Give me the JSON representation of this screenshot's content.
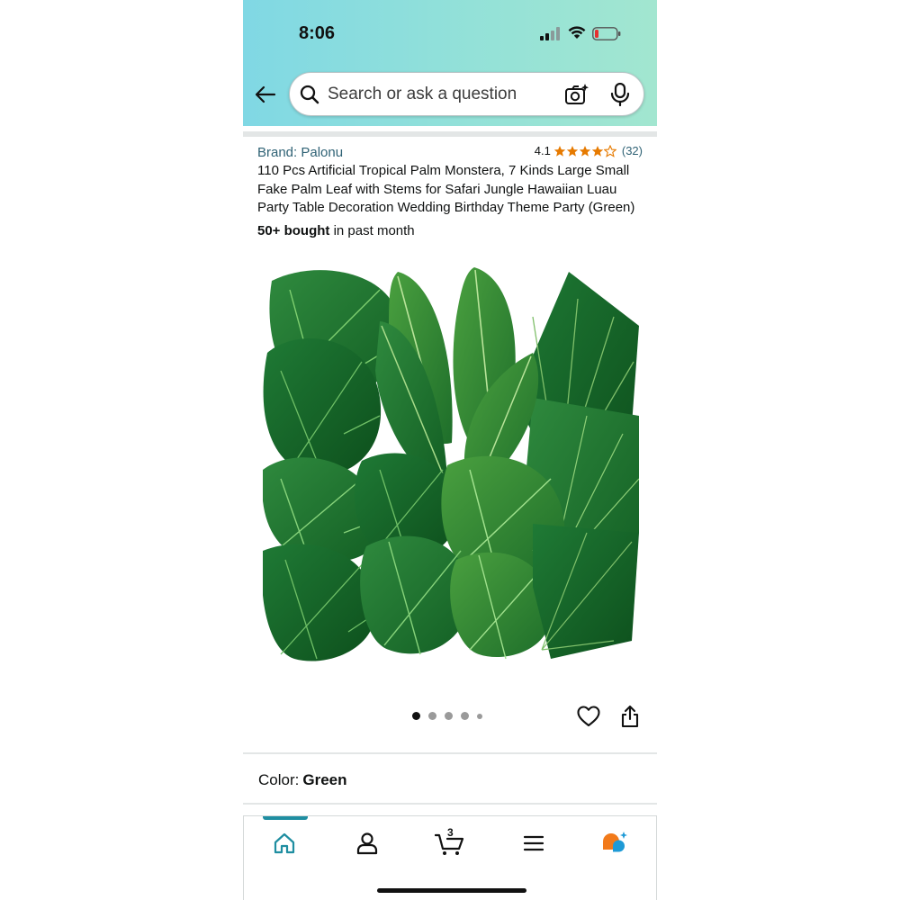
{
  "status_bar": {
    "time": "8:06"
  },
  "search": {
    "placeholder": "Search or ask a question"
  },
  "product": {
    "brand": "Brand: Palonu",
    "rating": "4.1",
    "stars": 4.1,
    "rating_count": "(32)",
    "title": "110 Pcs Artificial Tropical Palm Monstera, 7 Kinds Large Small Fake Palm Leaf with Stems for Safari Jungle Hawaiian Luau Party Table Decoration Wedding Birthday Theme Party (Green)",
    "bought_bold": "50+ bought",
    "bought_rest": " in past month"
  },
  "carousel": {
    "total": 5,
    "active": 1
  },
  "color": {
    "label": "Color:",
    "value": "Green"
  },
  "nav": {
    "items": [
      {
        "icon": "home-icon"
      },
      {
        "icon": "account-icon"
      },
      {
        "icon": "cart-icon",
        "count": "3"
      },
      {
        "icon": "menu-icon"
      },
      {
        "icon": "rufus-icon"
      }
    ],
    "active": "home-icon"
  },
  "colors": {
    "header_start": "#80d8e4",
    "header_end": "#a2e6d0",
    "link": "#2f6275",
    "star": "#e67a00",
    "nav_active": "#1f8ea1"
  }
}
